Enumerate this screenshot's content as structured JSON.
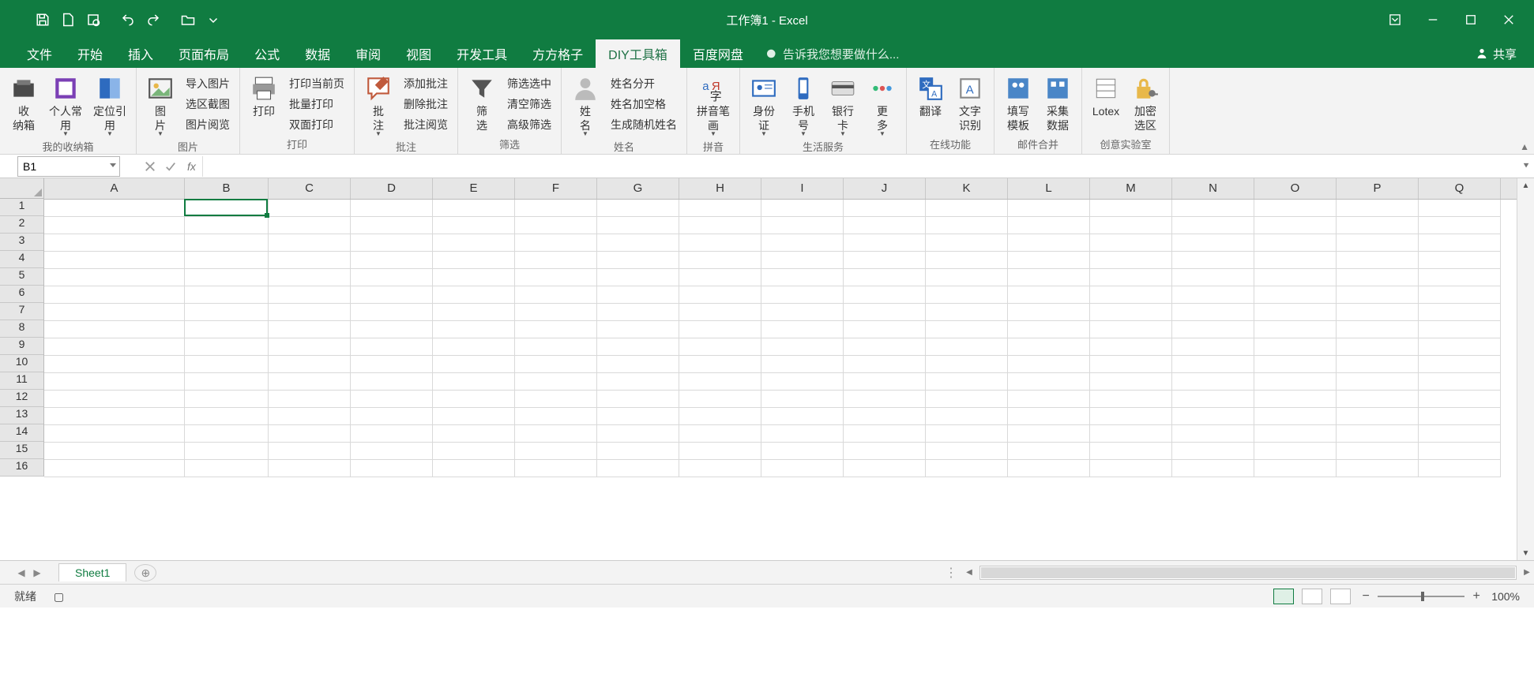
{
  "title": "工作簿1 - Excel",
  "share": "共享",
  "tell_me": "告诉我您想要做什么...",
  "tabs": [
    "文件",
    "开始",
    "插入",
    "页面布局",
    "公式",
    "数据",
    "审阅",
    "视图",
    "开发工具",
    "方方格子",
    "DIY工具箱",
    "百度网盘"
  ],
  "active_tab": "DIY工具箱",
  "ribbon": {
    "g1": {
      "label": "我的收纳箱",
      "items": [
        {
          "label": "收\n纳箱",
          "name": "inbox-button"
        },
        {
          "label": "个人常\n用",
          "name": "personal-freq-button",
          "dd": true
        },
        {
          "label": "定位引\n用",
          "name": "locate-ref-button",
          "dd": true
        }
      ]
    },
    "g2": {
      "label": "图片",
      "big": {
        "label": "图\n片",
        "name": "image-button",
        "dd": true
      },
      "items": [
        "导入图片",
        "选区截图",
        "图片阅览"
      ]
    },
    "g3": {
      "label": "打印",
      "big": {
        "label": "打印",
        "name": "print-button"
      },
      "items": [
        "打印当前页",
        "批量打印",
        "双面打印"
      ]
    },
    "g4": {
      "label": "批注",
      "big": {
        "label": "批\n注",
        "name": "comment-button",
        "dd": true
      },
      "items": [
        "添加批注",
        "删除批注",
        "批注阅览"
      ]
    },
    "g5": {
      "label": "筛选",
      "big": {
        "label": "筛\n选",
        "name": "filter-button"
      },
      "items": [
        "筛选选中",
        "清空筛选",
        "高级筛选"
      ]
    },
    "g6": {
      "label": "姓名",
      "big": {
        "label": "姓\n名",
        "name": "name-button",
        "dd": true
      },
      "items": [
        "姓名分开",
        "姓名加空格",
        "生成随机姓名"
      ]
    },
    "g7": {
      "label": "拼音",
      "items": [
        {
          "label": "拼音笔\n画",
          "name": "pinyin-button",
          "dd": true
        }
      ]
    },
    "g8": {
      "label": "生活服务",
      "items": [
        {
          "label": "身份\n证",
          "name": "id-card-button",
          "dd": true
        },
        {
          "label": "手机\n号",
          "name": "phone-button",
          "dd": true
        },
        {
          "label": "银行\n卡",
          "name": "bank-card-button",
          "dd": true
        },
        {
          "label": "更\n多",
          "name": "more-button",
          "dd": true
        }
      ]
    },
    "g9": {
      "label": "在线功能",
      "items": [
        {
          "label": "翻译",
          "name": "translate-button"
        },
        {
          "label": "文字\n识别",
          "name": "ocr-button"
        }
      ]
    },
    "g10": {
      "label": "邮件合并",
      "items": [
        {
          "label": "填写\n模板",
          "name": "fill-template-button"
        },
        {
          "label": "采集\n数据",
          "name": "collect-data-button"
        }
      ]
    },
    "g11": {
      "label": "创意实验室",
      "items": [
        {
          "label": "Lotex",
          "name": "lotex-button"
        },
        {
          "label": "加密\n选区",
          "name": "encrypt-selection-button"
        }
      ]
    }
  },
  "name_box": "B1",
  "fx": "fx",
  "sheet": {
    "active": "Sheet1"
  },
  "status": {
    "ready": "就绪",
    "zoom": "100%"
  },
  "columns": [
    "A",
    "B",
    "C",
    "D",
    "E",
    "F",
    "G",
    "H",
    "I",
    "J",
    "K",
    "L",
    "M",
    "N",
    "O",
    "P",
    "Q"
  ],
  "col_widths": {
    "A": 178,
    "B": 106
  },
  "default_col_width": 104,
  "rows": 16,
  "selected_cell": "B1"
}
